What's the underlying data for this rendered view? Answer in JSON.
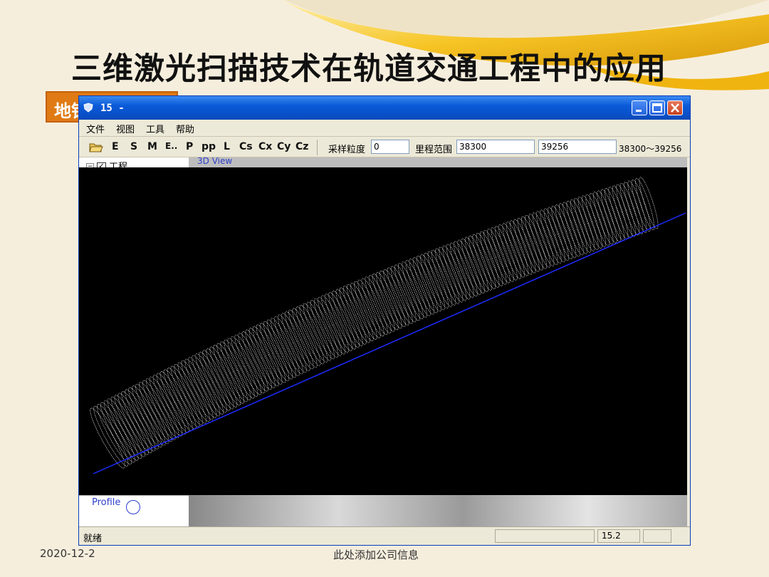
{
  "slide": {
    "title": "三维激光扫描技术在轨道交通工程中的应用",
    "section_tag": "地铁",
    "footer_date": "2020-12-2",
    "footer_company": "此处添加公司信息"
  },
  "window": {
    "title": "15 -",
    "menu": [
      "文件",
      "视图",
      "工具",
      "帮助"
    ],
    "toolbar": {
      "tools": [
        "E",
        "S",
        "M",
        "E..",
        "P",
        "pp",
        "L",
        "Cs",
        "Cx",
        "Cy",
        "Cz"
      ],
      "sampling_label": "采样粒度",
      "sampling_value": "0",
      "mileage_label": "里程范围",
      "mileage_start": "38300",
      "mileage_end": "39256",
      "range_text": "38300～39256"
    },
    "tree": {
      "root_label": "工程"
    },
    "view_label": "3D View",
    "profile_label": "Profile",
    "status": {
      "text": "就绪",
      "zoom": "15.2"
    }
  },
  "colors": {
    "title_bar": "#0a5ad8",
    "axis_line": "#1d2cff",
    "tag": "#e07a14"
  }
}
